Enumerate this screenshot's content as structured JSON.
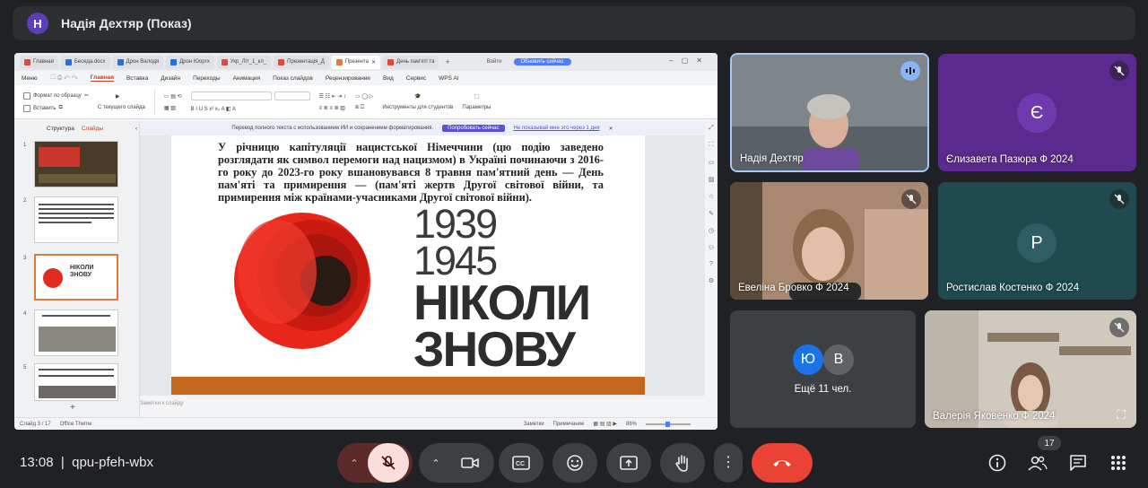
{
  "meet": {
    "presenter_initial": "Н",
    "presenter_title": "Надія Дехтяр (Показ)",
    "time": "13:08",
    "meeting_code": "qpu-pfeh-wbx",
    "people_count": "17",
    "accent": "#ea4335"
  },
  "wps": {
    "tabs": [
      {
        "label": "Главная",
        "color": "#d94b3f"
      },
      {
        "label": "Беседа.docx",
        "color": "#2b6fd6"
      },
      {
        "label": "Дрон Валодя",
        "color": "#2b6fd6"
      },
      {
        "label": "Дрон Юоргх",
        "color": "#2b6fd6"
      },
      {
        "label": "Укр_Літ_1_кл_",
        "color": "#d94b3f"
      },
      {
        "label": "Презентація_Д",
        "color": "#d94b3f"
      },
      {
        "label": "Презента",
        "color": "#e07a3c"
      },
      {
        "label": "День пам'яті та",
        "color": "#d94b3f"
      }
    ],
    "user": "Войти",
    "update_button": "Обновить сейчас",
    "menu": [
      "Меню",
      "Главная",
      "Вставка",
      "Дизайн",
      "Переходы",
      "Анимация",
      "Показ слайдов",
      "Рецензирование",
      "Вид",
      "Сервис",
      "WPS AI"
    ],
    "ribbon": {
      "format_painter": "Формат по образцу",
      "paste": "Вставить",
      "from_slide": "С текущего слайда",
      "student_tools": "Инструменты для студентов",
      "params": "Параметры"
    },
    "side_tabs": {
      "structure": "Структура",
      "slides": "Слайды"
    },
    "thumb_numbers": [
      "1",
      "2",
      "3",
      "4",
      "5"
    ],
    "notification": {
      "text": "Перевод полного текста с использованием ИИ и сохранением форматирования.",
      "button": "Попробовать сейчас",
      "dismiss": "Не показывай мне это через 1 дня"
    },
    "slide": {
      "paragraph": "У річницю капітуляції нацистської Німеччини (цю подію заведено розглядати як символ перемоги над нацизмом) в Україні починаючи з 2016-го року до 2023-го року вшановувався 8 травня пам'ятний день — День пам'яті та примирення — (пам'яті жертв Другої світової війни, та примирення між країнами-учасниками Другої світової війни).",
      "year1": "1939",
      "year2": "1945",
      "line1": "НІКОЛИ",
      "line2": "ЗНОВУ"
    },
    "notes_placeholder": "Заметки к слайду",
    "status": {
      "slide_counter": "Слайд 3 / 17",
      "theme": "Office Theme",
      "notes": "Заметки",
      "comments": "Примечание",
      "zoom": "86%"
    }
  },
  "participants": [
    {
      "name": "Надія Дехтяр",
      "speaking": true
    },
    {
      "name": "Єлизавета Пазюра Ф 2024",
      "initial": "Є",
      "bg": "#5b2a8e",
      "avatar": "#6f3aad"
    },
    {
      "name": "Евеліна Бровко Ф 2024"
    },
    {
      "name": "Ростислав Костенко Ф 2024",
      "initial": "Р",
      "bg": "#1f4a4f",
      "avatar": "#2e5e63"
    },
    {
      "name": "Ещё 11 чел.",
      "initials": [
        "Ю",
        "В"
      ]
    },
    {
      "name": "Валерія Яковенко Ф 2024"
    }
  ]
}
